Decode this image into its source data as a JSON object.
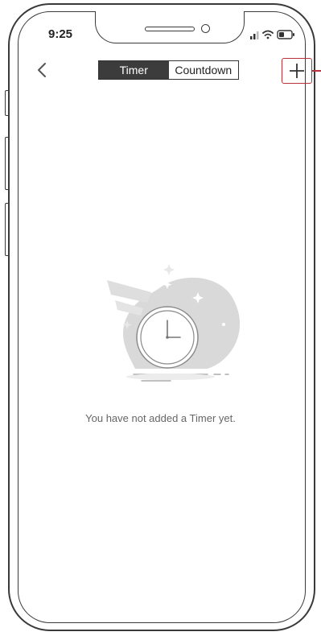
{
  "status_bar": {
    "time": "9:25",
    "icons": [
      "signal-icon",
      "wifi-icon",
      "battery-icon"
    ]
  },
  "nav": {
    "back_icon": "chevron-left-icon",
    "tabs": [
      {
        "label": "Timer",
        "active": true
      },
      {
        "label": "Countdown",
        "active": false
      }
    ],
    "add_icon": "plus-icon"
  },
  "empty_state": {
    "illustration": "clock-icon",
    "message": "You have not added a Timer yet."
  },
  "colors": {
    "active_tab": "#3c3c3c",
    "highlight": "#b8323a",
    "illustration": "#d9d9d9"
  }
}
